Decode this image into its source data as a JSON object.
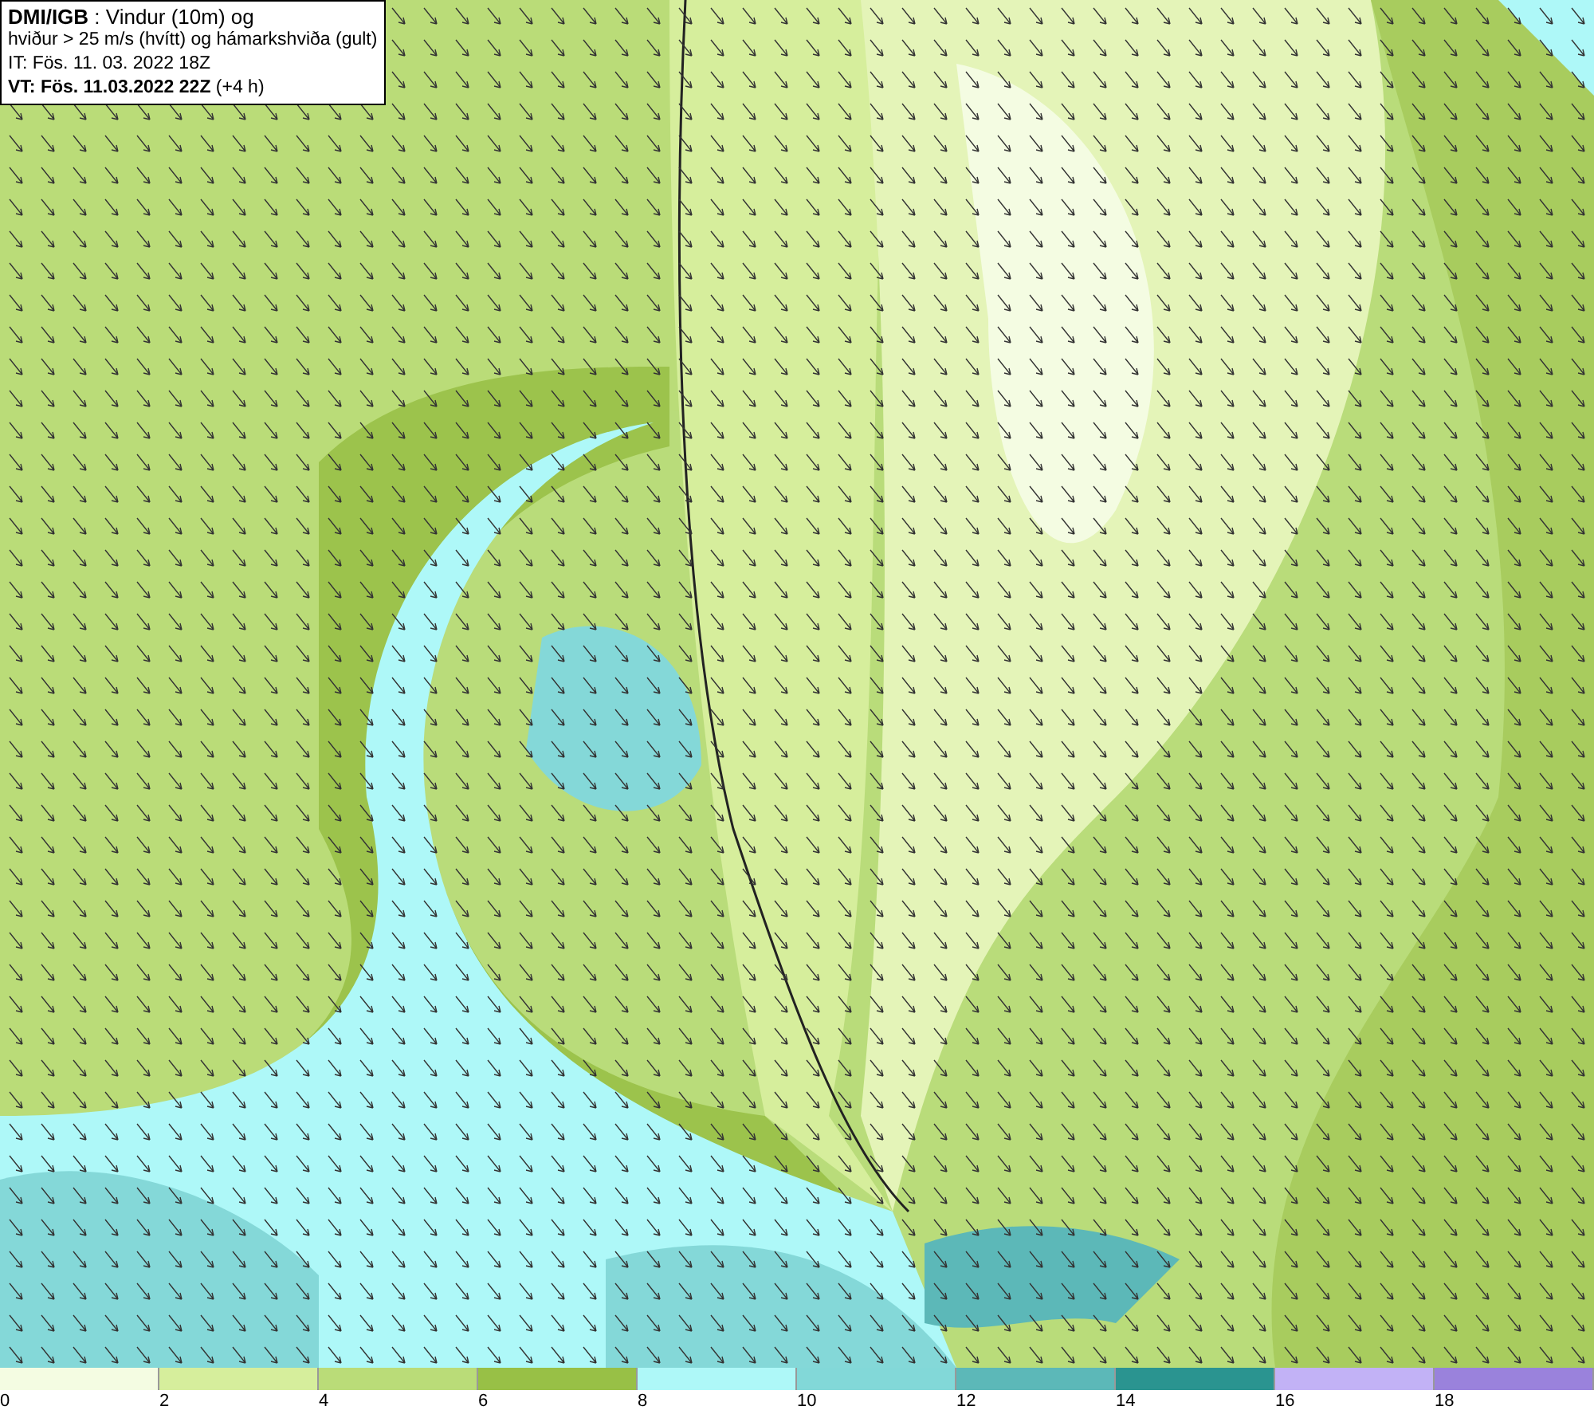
{
  "info_box": {
    "lines": [
      "**DMI/IGB** : Vindur (10m) og",
      "hviður > 25 m/s (hvítt) og hámarkshviða (gult)",
      "IT: Fös. 11. 03. 2022 18Z",
      "**VT: Fös. 11.03.2022 22Z** (+4 h)"
    ]
  },
  "legend": [
    {
      "label": "0",
      "color": "#f4fce2"
    },
    {
      "label": "2",
      "color": "#d6ee9c"
    },
    {
      "label": "4",
      "color": "#badc78"
    },
    {
      "label": "6",
      "color": "#98c046"
    },
    {
      "label": "8",
      "color": "#aef8f8"
    },
    {
      "label": "10",
      "color": "#82d8d8"
    },
    {
      "label": "12",
      "color": "#5cb8b8"
    },
    {
      "label": "14",
      "color": "#2a9490"
    },
    {
      "label": "16",
      "color": "#c2b2f6"
    },
    {
      "label": "18",
      "color": "#9a82dc"
    }
  ]
}
